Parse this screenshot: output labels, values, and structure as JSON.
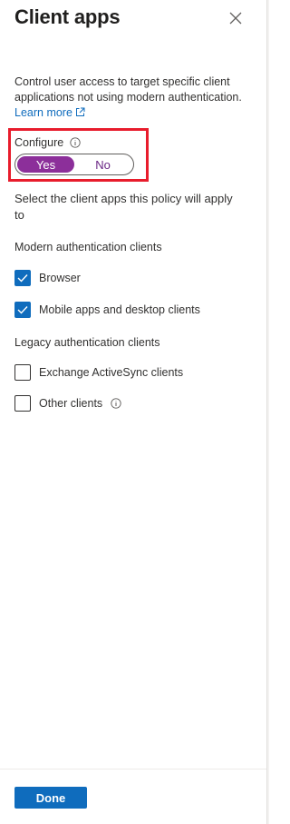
{
  "panel": {
    "title": "Client apps",
    "description": "Control user access to target specific client applications not using modern authentication.",
    "learn_more": "Learn more"
  },
  "configure": {
    "label": "Configure",
    "options": [
      "Yes",
      "No"
    ],
    "selected": "Yes"
  },
  "select_text": "Select the client apps this policy will apply to",
  "modern": {
    "heading": "Modern authentication clients",
    "items": [
      {
        "label": "Browser",
        "checked": true
      },
      {
        "label": "Mobile apps and desktop clients",
        "checked": true
      }
    ]
  },
  "legacy": {
    "heading": "Legacy authentication clients",
    "items": [
      {
        "label": "Exchange ActiveSync clients",
        "checked": false
      },
      {
        "label": "Other clients",
        "checked": false
      }
    ]
  },
  "footer": {
    "done_label": "Done"
  },
  "colors": {
    "accent": "#0f6cbd",
    "toggle_on": "#8c2f9a",
    "highlight": "#e81c2c"
  }
}
